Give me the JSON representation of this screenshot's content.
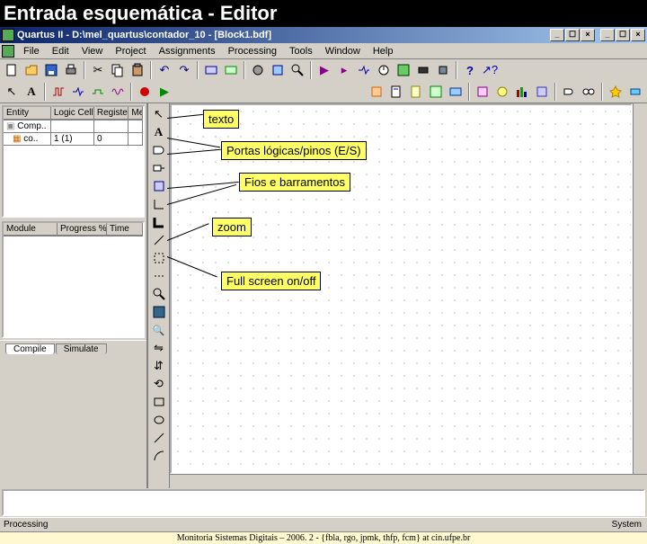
{
  "slide_title": "Entrada esquemática - Editor",
  "titlebar": {
    "title": "Quartus II - D:\\mel_quartus\\contador_10 - [Block1.bdf]",
    "min": "_",
    "max": "☐",
    "close": "×"
  },
  "menus": [
    "File",
    "Edit",
    "View",
    "Project",
    "Assignments",
    "Processing",
    "Tools",
    "Window",
    "Help"
  ],
  "hier_panel": {
    "headers": [
      "Entity",
      "Logic Cells",
      "Registers",
      "Me"
    ],
    "rows": [
      {
        "icon": "chip",
        "name": "Comp..",
        "cells": "",
        "regs": "",
        "me": ""
      },
      {
        "icon": "block",
        "name": "co..",
        "cells": "1 (1)",
        "regs": "0",
        "me": ""
      }
    ]
  },
  "status_panel": {
    "headers": [
      "Module",
      "Progress %",
      "Time"
    ]
  },
  "tabs": {
    "compile": "Compile",
    "simulate": "Simulate"
  },
  "statusbar": {
    "left": "Processing",
    "right": "System"
  },
  "callouts": {
    "texto": "texto",
    "portas": "Portas lógicas/pinos (E/S)",
    "fios": "Fios e barramentos",
    "zoom": "zoom",
    "fullscreen": "Full screen on/off"
  },
  "footer": "Monitoria Sistemas Digitais  –  2006. 2  -  {fbla, rgo, jpmk, thfp, fcm} at cin.ufpe.br"
}
